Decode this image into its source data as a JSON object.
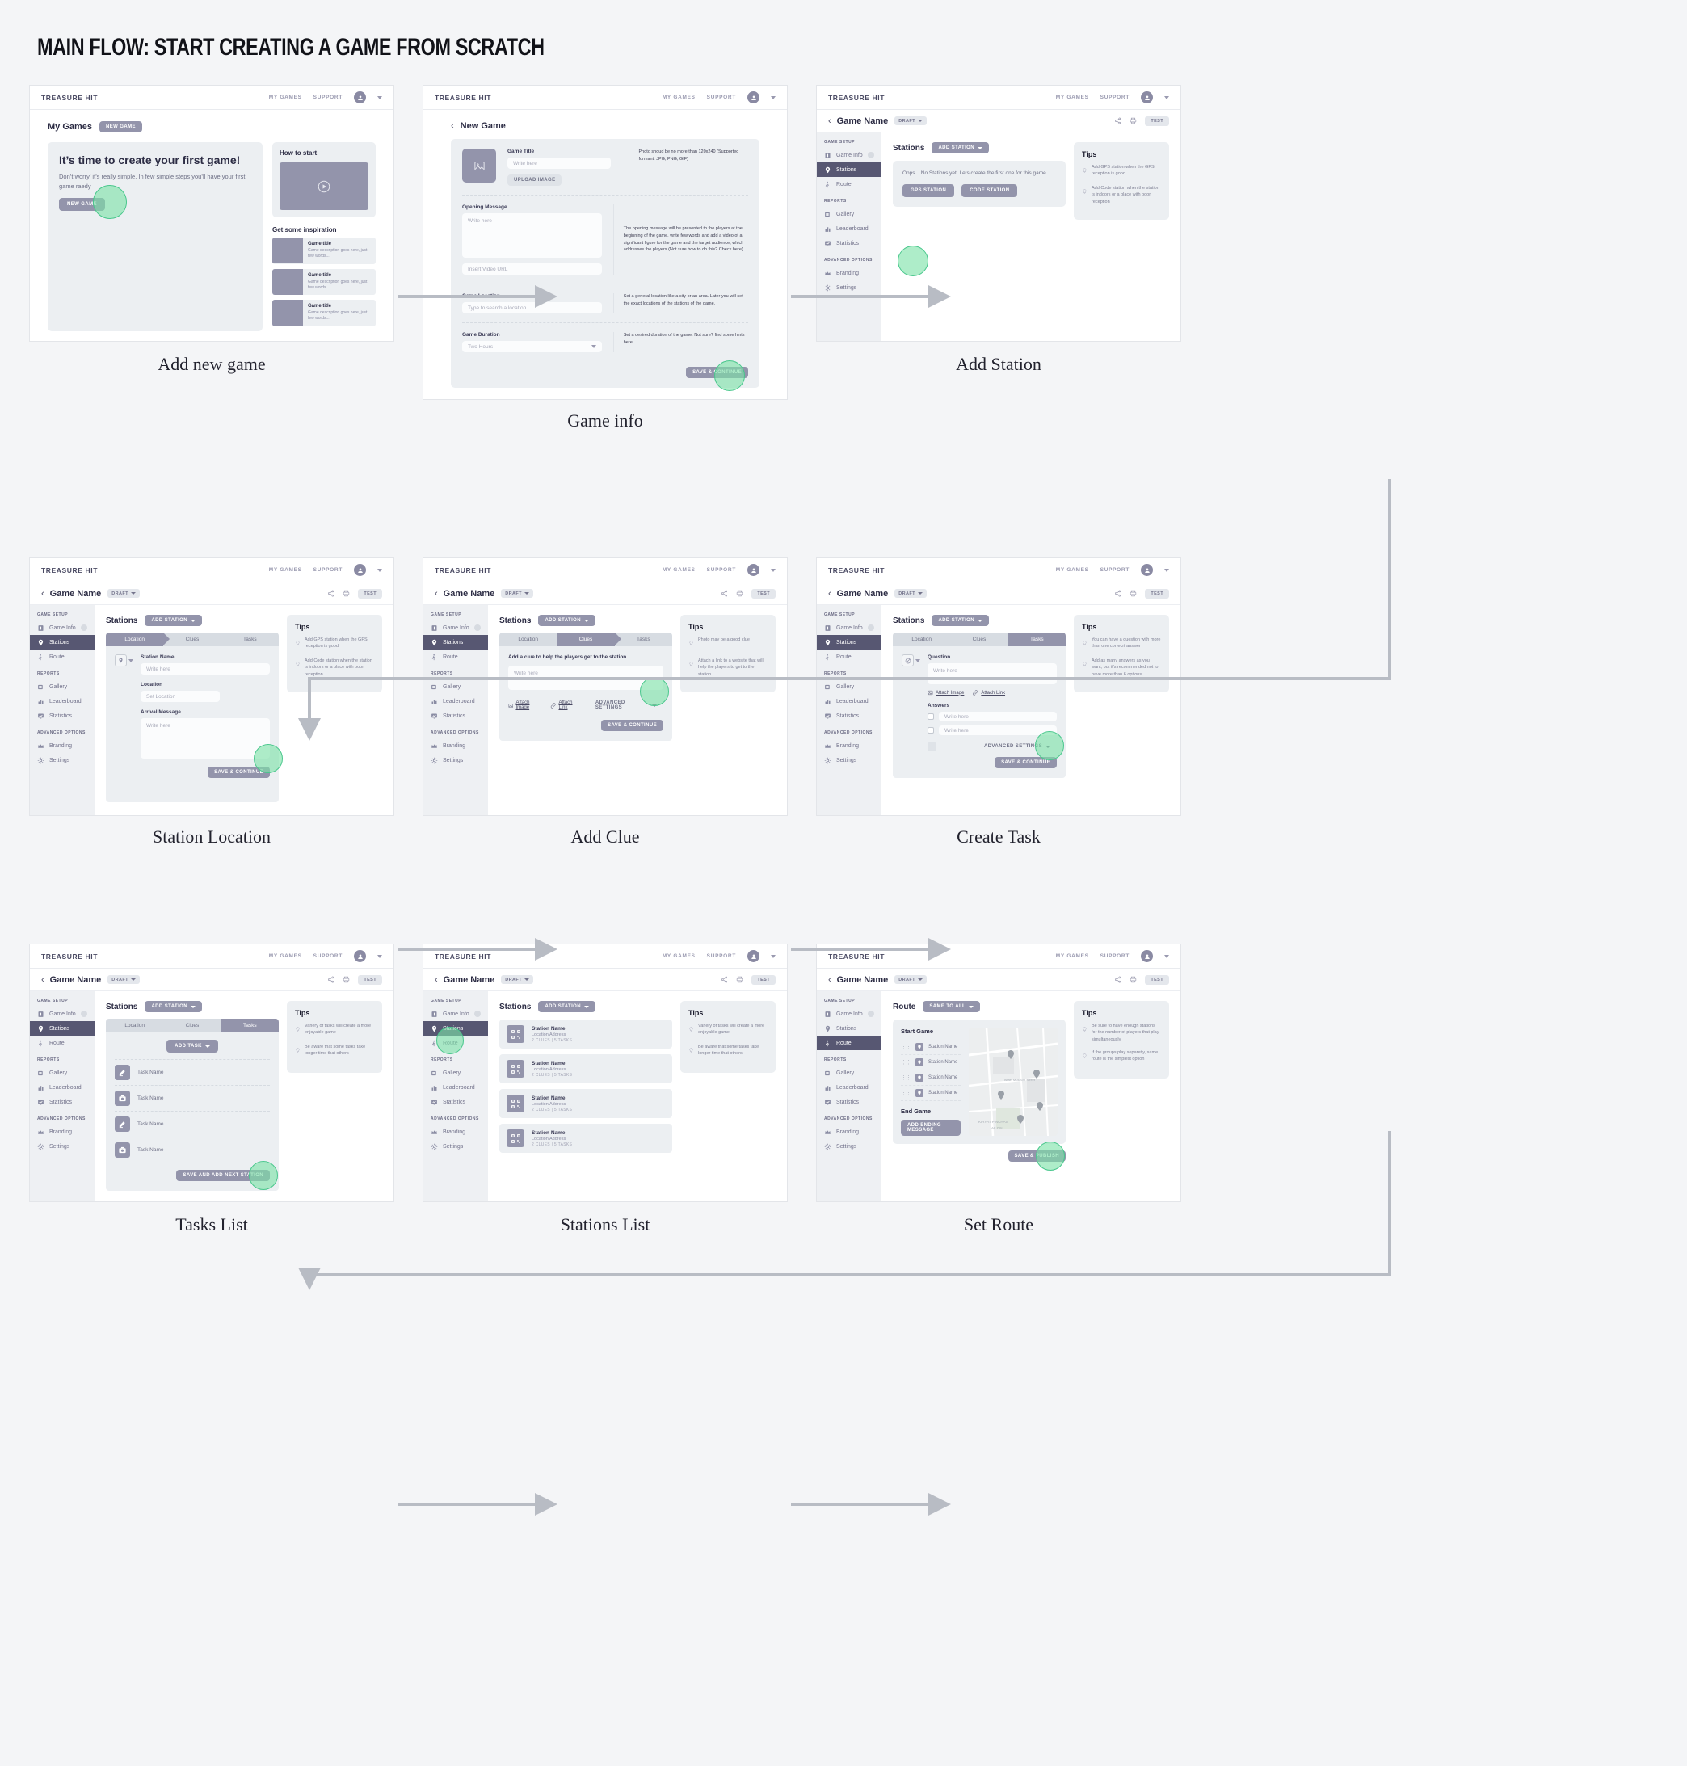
{
  "title": "MAIN FLOW: START CREATING A GAME FROM SCRATCH",
  "brand": "TREASURE HIT",
  "topnav": {
    "my_games": "MY GAMES",
    "support": "SUPPORT"
  },
  "sidebar": {
    "groups": [
      {
        "label": "GAME SETUP",
        "items": [
          {
            "label": "Game Info",
            "icon": "info-icon"
          },
          {
            "label": "Stations",
            "icon": "pin-icon"
          },
          {
            "label": "Route",
            "icon": "walk-icon"
          }
        ]
      },
      {
        "label": "REPORTS",
        "items": [
          {
            "label": "Gallery",
            "icon": "gallery-icon"
          },
          {
            "label": "Leaderboard",
            "icon": "bars-icon"
          },
          {
            "label": "Statistics",
            "icon": "stats-icon"
          }
        ]
      },
      {
        "label": "ADVANCED OPTIONS",
        "items": [
          {
            "label": "Branding",
            "icon": "crown-icon"
          },
          {
            "label": "Settings",
            "icon": "gear-icon"
          }
        ]
      }
    ]
  },
  "common": {
    "game_name": "Game Name",
    "draft": "DRAFT",
    "test": "TEST",
    "stations_title": "Stations",
    "add_station": "ADD STATION",
    "save_continue": "SAVE & CONTINUE",
    "tips_title": "Tips",
    "steps": [
      "Location",
      "Clues",
      "Tasks"
    ],
    "write_here": "Write here"
  },
  "screens": {
    "add_new_game": {
      "caption": "Add new game",
      "my_games": "My Games",
      "new_game_pill": "NEW GAME",
      "hero_title": "It’s time to create your first game!",
      "hero_sub": "Don’t worry’ it’s really simple. In few simple steps you’ll have your first game raedy",
      "hero_btn": "NEW GAME",
      "how_to_start": "How to start",
      "get_inspiration": "Get some inspiration",
      "cards": [
        {
          "title": "Game title",
          "desc": "Game description goes here, just few words..."
        },
        {
          "title": "Game title",
          "desc": "Game description goes here, just few words..."
        },
        {
          "title": "Game title",
          "desc": "Game description goes here, just few words..."
        }
      ]
    },
    "game_info": {
      "caption": "Game info",
      "heading": "New Game",
      "game_title_label": "Game Title",
      "game_title_placeholder": "Write here",
      "upload_image": "UPLOAD IMAGE",
      "photo_hint": "Photo shoud be no more than 120x240 (Supported formant: JPG, PNG, GIF)",
      "opening_label": "Opening Message",
      "opening_placeholder": "Write here",
      "video_placeholder": "Insert Video URL",
      "opening_hint": "The opening message will be presented to the players at the beginning of the game. write few words and add a video of a significant figure for the game and the target audience, which addresses the players (Not sure how to do this? Check here).",
      "opening_hint_link": "Check here",
      "location_label": "Game Location",
      "location_placeholder": "Type to search a location",
      "location_hint": "Set a general location like a city or an area. Later you will set the exact locations of the stations of the game.",
      "duration_label": "Game Duration",
      "duration_value": "Two Hours",
      "duration_hint": "Set a desired duration of the game. Not sure? find some hints here",
      "duration_hint_link": "here",
      "save_continue": "SAVE & CONTINUE"
    },
    "add_station": {
      "caption": "Add Station",
      "empty_text": "Opps... No Stations yet. Lets create the first one for this game",
      "gps_btn": "GPS STATION",
      "code_btn": "CODE STATION",
      "tips": [
        "Add GPS station when the GPS reception is good",
        "Add Code station when the station is indoors or a place with poor reception"
      ]
    },
    "station_location": {
      "caption": "Station Location",
      "station_name_label": "Station Name",
      "station_name_placeholder": "Write here",
      "location_label": "Location",
      "location_placeholder": "Set  Location",
      "arrival_label": "Arrival Message",
      "arrival_placeholder": "Write here",
      "tips": [
        "Add GPS station when the GPS reception is good",
        "Add Code station when the station is indoors or a place with poor reception"
      ]
    },
    "add_clue": {
      "caption": "Add Clue",
      "prompt": "Add a clue to help the players get to the station",
      "placeholder": "Write here",
      "attach_image": "Attach Image",
      "attach_link": "Attach Link",
      "advanced_settings": "ADVANCED SETTINGS",
      "tips": [
        "Photo may be a good clue",
        "Attach a link to a website that will help the players to get to the station"
      ]
    },
    "create_task": {
      "caption": "Create Task",
      "question_label": "Question",
      "question_placeholder": "Write here",
      "attach_image": "Attach Image",
      "attach_link": "Attach Link",
      "answers_label": "Answers",
      "answer_placeholder": "Write here",
      "add_answer": "+",
      "advanced_settings": "ADVANCED SETTINGS",
      "tips": [
        "You can have a question with more than one correcrt answer",
        "Add as many answers as you want, but it’s recommended not to have more than 6 options"
      ]
    },
    "tasks_list": {
      "caption": "Tasks List",
      "add_task": "ADD TASK",
      "tasks": [
        {
          "name": "Task Name",
          "icon": "pencil-icon"
        },
        {
          "name": "Task Name",
          "icon": "camera-icon"
        },
        {
          "name": "Task Name",
          "icon": "pencil-icon"
        },
        {
          "name": "Task Name",
          "icon": "camera-icon"
        }
      ],
      "save_btn": "SAVE AND ADD NEXT STATION",
      "tips": [
        "Variery of tasks will create a more enjoyable game",
        "Be aware that some tasks take longer time that others"
      ]
    },
    "stations_list": {
      "caption": "Stations List",
      "stations": [
        {
          "name": "Station Name",
          "address": "Location Address",
          "meta": "2 CLUES  |  5 TASKS"
        },
        {
          "name": "Station Name",
          "address": "Location Address",
          "meta": "2 CLUES  |  5 TASKS"
        },
        {
          "name": "Station Name",
          "address": "Location Address",
          "meta": "2 CLUES  |  5 TASKS"
        },
        {
          "name": "Station Name",
          "address": "Location Address",
          "meta": "2 CLUES  |  5 TASKS"
        }
      ],
      "tips": [
        "Variery of tasks will create a more enjoyable game",
        "Be aware that some tasks take longer time that others"
      ]
    },
    "set_route": {
      "caption": "Set Route",
      "route_title": "Route",
      "same_to_all": "SAME TO ALL",
      "start_game": "Start Game",
      "end_game": "End Game",
      "add_ending": "ADD ENDING MESSAGE",
      "save_btn": "SAVE & PUBLISH",
      "stations": [
        "Station Name",
        "Station Name",
        "Station Name",
        "Station Name"
      ],
      "map_labels": [
        "KIRYAT PINCHAS",
        "AILON"
      ],
      "tips": [
        "Be sure to have enough stations for the number of players that play simultaneously",
        "If the groups play separetly, same route is the simplest option"
      ]
    }
  },
  "colors": {
    "accent_green": "#7de2a8",
    "purple": "#575772",
    "grey_btn": "#9394ab",
    "bg": "#f4f5f7"
  }
}
